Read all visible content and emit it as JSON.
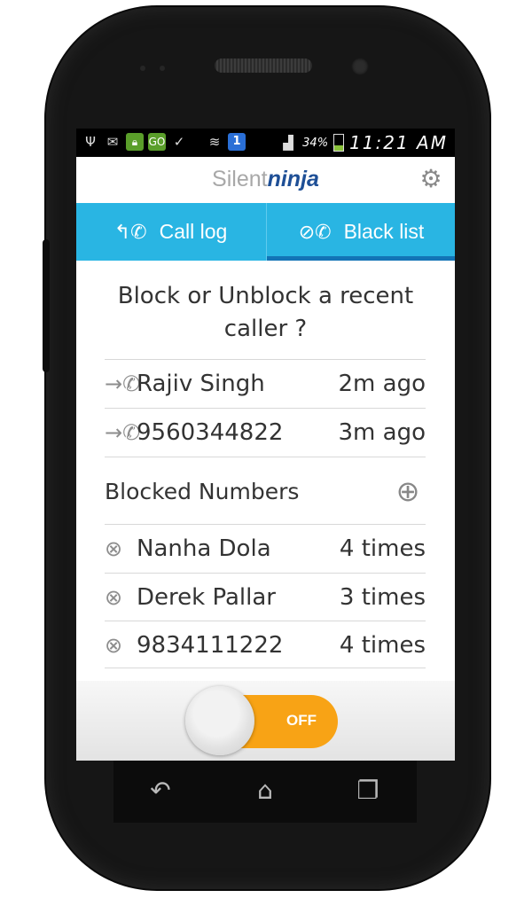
{
  "status_bar": {
    "icons": [
      "usb-icon",
      "gmail-icon",
      "lock-icon",
      "go-sms-icon",
      "briefcase-icon",
      "wifi-icon",
      "sim-1-icon",
      "signal-icon",
      "battery-icon"
    ],
    "battery_percent": "34%",
    "time": "11:21 AM",
    "sim_badge": "1"
  },
  "app_bar": {
    "brand_light": "Silent",
    "brand_bold": "ninja",
    "settings_icon": "gear-icon"
  },
  "tabs": [
    {
      "label": "Call log",
      "icon": "call-log-icon",
      "selected": false
    },
    {
      "label": "Black list",
      "icon": "block-call-icon",
      "selected": true
    }
  ],
  "prompt": "Block or Unblock a recent caller ?",
  "recent_callers": [
    {
      "name": "Rajiv Singh",
      "time": "2m ago",
      "icon": "incoming-call-icon"
    },
    {
      "name": "9560344822",
      "time": "3m ago",
      "icon": "incoming-call-icon"
    }
  ],
  "blocked_section": {
    "title": "Blocked Numbers",
    "add_icon": "add-contact-icon"
  },
  "blocked_numbers": [
    {
      "name": "Nanha Dola",
      "count": "4 times",
      "icon": "blocked-icon"
    },
    {
      "name": "Derek Pallar",
      "count": "3 times",
      "icon": "blocked-icon"
    },
    {
      "name": "9834111222",
      "count": "4 times",
      "icon": "blocked-icon"
    }
  ],
  "toggle": {
    "label": "OFF",
    "state": "off"
  },
  "nav_bar": {
    "buttons": [
      "back-icon",
      "home-icon",
      "recent-apps-icon"
    ]
  },
  "colors": {
    "tab_bar": "#29b5e3",
    "tab_indicator": "#1274b6",
    "toggle_off": "#f8a315",
    "brand_bold": "#1e4f96"
  }
}
